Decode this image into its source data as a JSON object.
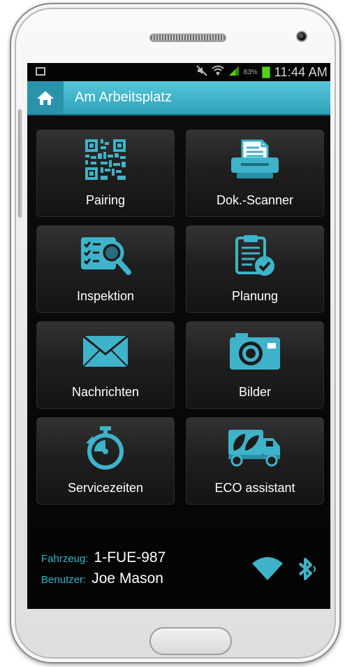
{
  "status_bar": {
    "battery_percent": "83%",
    "time": "11:44 AM",
    "icons": [
      "picture-icon",
      "mute-icon",
      "wifi-icon",
      "signal-icon",
      "battery-icon"
    ]
  },
  "app_bar": {
    "title": "Am Arbeitsplatz",
    "home_icon": "home-icon"
  },
  "tiles": [
    {
      "label": "Pairing",
      "icon": "qr-code-icon"
    },
    {
      "label": "Dok.-Scanner",
      "icon": "scanner-icon"
    },
    {
      "label": "Inspektion",
      "icon": "checklist-search-icon"
    },
    {
      "label": "Planung",
      "icon": "clipboard-check-icon"
    },
    {
      "label": "Nachrichten",
      "icon": "envelope-icon"
    },
    {
      "label": "Bilder",
      "icon": "camera-icon"
    },
    {
      "label": "Servicezeiten",
      "icon": "stopwatch-icon"
    },
    {
      "label": "ECO assistant",
      "icon": "eco-truck-icon"
    }
  ],
  "footer": {
    "vehicle_label": "Fahrzeug:",
    "vehicle_value": "1-FUE-987",
    "user_label": "Benutzer:",
    "user_value": "Joe Mason"
  },
  "colors": {
    "accent": "#33b6cf",
    "app_bar": "#3fb3c9",
    "battery": "#54d11c"
  }
}
